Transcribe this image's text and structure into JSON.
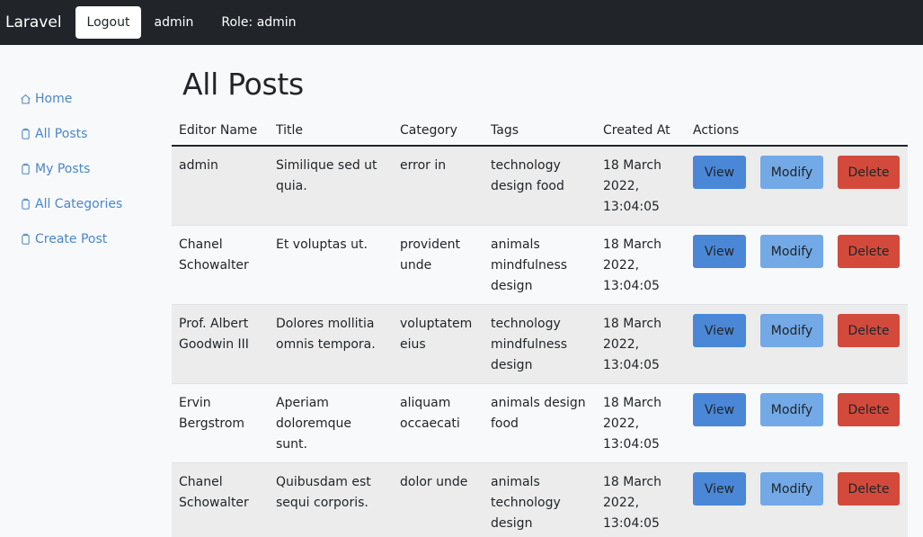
{
  "navbar": {
    "brand": "Laravel",
    "logout_label": "Logout",
    "user": "admin",
    "role": "Role: admin"
  },
  "sidebar": {
    "items": [
      {
        "label": "Home",
        "icon": "home-icon"
      },
      {
        "label": "All Posts",
        "icon": "file-icon"
      },
      {
        "label": "My Posts",
        "icon": "file-icon"
      },
      {
        "label": "All Categories",
        "icon": "file-icon"
      },
      {
        "label": "Create Post",
        "icon": "file-icon"
      }
    ]
  },
  "main": {
    "title": "All Posts",
    "columns": [
      "Editor Name",
      "Title",
      "Category",
      "Tags",
      "Created At",
      "Actions"
    ],
    "actions": {
      "view": "View",
      "modify": "Modify",
      "delete": "Delete"
    },
    "rows": [
      {
        "editor": "admin",
        "title": "Similique sed ut quia.",
        "category": "error in",
        "tags": "technology design food",
        "created": "18 March 2022, 13:04:05"
      },
      {
        "editor": "Chanel Schowalter",
        "title": "Et voluptas ut.",
        "category": "provident unde",
        "tags": "animals mindfulness design",
        "created": "18 March 2022, 13:04:05"
      },
      {
        "editor": "Prof. Albert Goodwin III",
        "title": "Dolores mollitia omnis tempora.",
        "category": "voluptatem eius",
        "tags": "technology mindfulness design",
        "created": "18 March 2022, 13:04:05"
      },
      {
        "editor": "Ervin Bergstrom",
        "title": "Aperiam doloremque sunt.",
        "category": "aliquam occaecati",
        "tags": "animals design food",
        "created": "18 March 2022, 13:04:05"
      },
      {
        "editor": "Chanel Schowalter",
        "title": "Quibusdam est sequi corporis.",
        "category": "dolor unde",
        "tags": "animals technology design",
        "created": "18 March 2022, 13:04:05"
      }
    ]
  },
  "colors": {
    "navbar": "#212529",
    "link": "#4a87c9",
    "view": "#4a87d6",
    "modify": "#72a9e6",
    "delete": "#d34a3c"
  }
}
